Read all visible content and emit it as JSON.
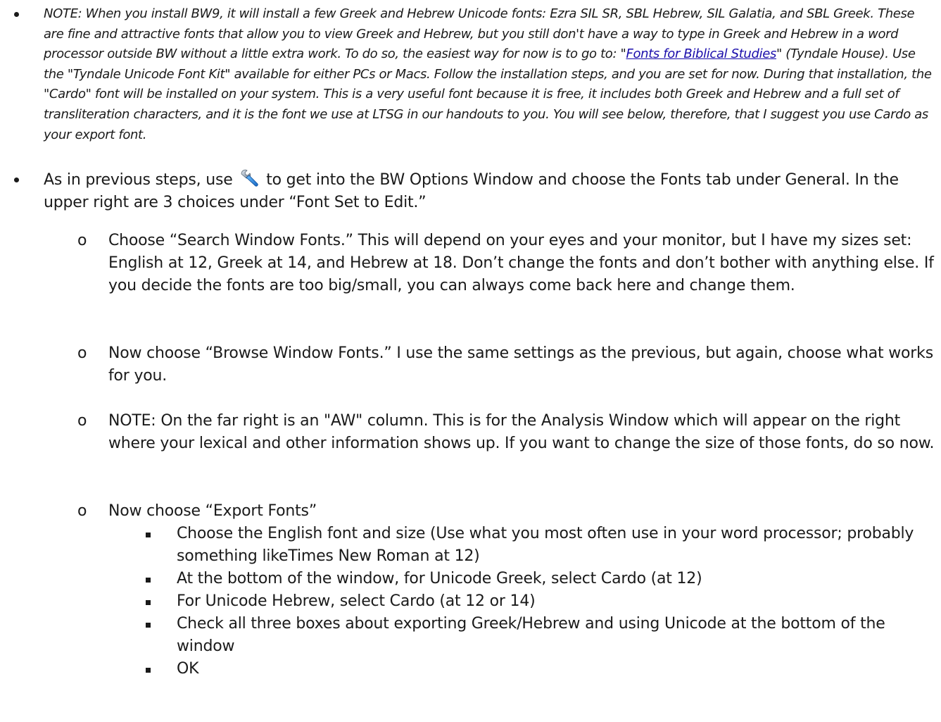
{
  "note_paragraph": {
    "before_link": "NOTE: When you install BW9, it will install a few Greek and Hebrew Unicode fonts: Ezra SIL SR, SBL Hebrew, SIL Galatia, and SBL Greek. These are fine and attractive fonts that allow you to view Greek and Hebrew, but you still don't have a way to type in Greek and Hebrew in a word processor outside BW without a little extra work. To do so, the easiest way for now is to go to: \"",
    "link_text": "Fonts for Biblical Studies",
    "after_link": "\" (Tyndale House). Use the \"Tyndale Unicode Font Kit\" available for either PCs or Macs. Follow the installation steps, and you are set for now. During that installation, the \"Cardo\" font will be installed on your system. This is a very useful font because it is free, it includes both Greek and Hebrew and a full set of transliteration characters, and it is the font we use at LTSG in our handouts to you. You will see below, therefore, that I suggest you use Cardo as your export font."
  },
  "main_bullet": {
    "before_icon": "As in previous steps, use",
    "icon": "wrench-icon",
    "after_icon": "to get into the BW Options Window and choose the Fonts tab under General. In the upper right are 3 choices under “Font Set to Edit.”"
  },
  "sub_items": [
    {
      "marker": "o",
      "text": "Choose “Search Window Fonts.” This will depend on your eyes and your monitor, but I have my sizes set: English at 12, Greek at 14, and Hebrew at 18. Don’t change the fonts and don’t bother with anything else. If you decide the fonts are too big/small, you can always come back here and change them."
    },
    {
      "marker": "o",
      "text": "Now choose “Browse Window Fonts.” I use the same settings as the previous, but again, choose what works for you."
    },
    {
      "marker": "o",
      "text": "NOTE: On the far right is an \"AW\" column. This is for the Analysis Window which will appear on the right where your lexical and other information shows up. If you want to change the size of those fonts, do so now."
    },
    {
      "marker": "o",
      "text": "Now choose “Export Fonts”"
    }
  ],
  "export_steps": [
    "Choose the English font and size (Use what you most often use in your word processor; probably something likeTimes New Roman at 12)",
    "At the bottom of the window, for Unicode Greek, select Cardo (at 12)",
    "For Unicode Hebrew, select Cardo (at 12 or 14)",
    "Check all three boxes about exporting Greek/Hebrew and using Unicode at the bottom of the window",
    "OK"
  ]
}
